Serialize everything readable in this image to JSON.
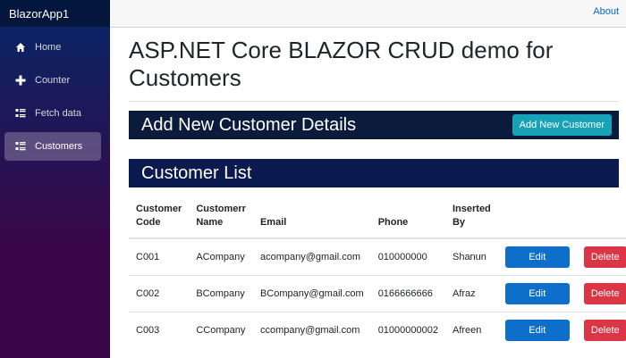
{
  "brand": "BlazorApp1",
  "nav": [
    {
      "label": "Home",
      "icon": "home-icon"
    },
    {
      "label": "Counter",
      "icon": "plus-icon"
    },
    {
      "label": "Fetch data",
      "icon": "list-icon"
    },
    {
      "label": "Customers",
      "icon": "list-icon"
    }
  ],
  "top": {
    "about": "About"
  },
  "page": {
    "title": "ASP.NET Core BLAZOR CRUD demo for Customers",
    "add_section_title": "Add New Customer Details",
    "add_button": "Add New Customer",
    "list_section_title": "Customer List"
  },
  "table": {
    "headers": [
      "Customer Code",
      "Customerr Name",
      "Email",
      "Phone",
      "Inserted By"
    ],
    "rows": [
      {
        "code": "C001",
        "name": "ACompany",
        "email": "acompany@gmail.com",
        "phone": "010000000",
        "inserted_by": "Shanun"
      },
      {
        "code": "C002",
        "name": "BCompany",
        "email": "BCompany@gmail.com",
        "phone": "0166666666",
        "inserted_by": "Afraz"
      },
      {
        "code": "C003",
        "name": "CCompany",
        "email": "ccompany@gmail.com",
        "phone": "01000000002",
        "inserted_by": "Afreen"
      }
    ],
    "edit_label": "Edit",
    "delete_label": "Delete"
  },
  "colors": {
    "accent": "#17a2b8",
    "edit": "#0d6fc9",
    "delete": "#dc3545",
    "section_bar": "#0b1a4e"
  }
}
